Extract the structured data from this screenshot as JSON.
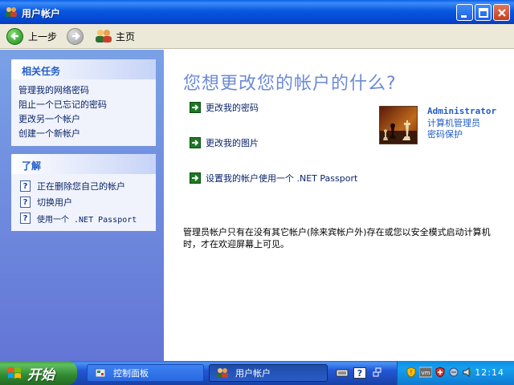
{
  "window": {
    "title": "用户帐户"
  },
  "toolbar": {
    "back_label": "上一步",
    "home_label": "主页"
  },
  "sidebar": {
    "tasks_header": "相关任务",
    "tasks": [
      "管理我的网络密码",
      "阻止一个已忘记的密码",
      "更改另一个帐户",
      "创建一个新帐户"
    ],
    "learn_header": "了解",
    "learn": [
      "正在删除您自己的帐户",
      "切换用户",
      "使用一个 .NET Passport"
    ]
  },
  "main": {
    "heading": "您想更改您的帐户的什么?",
    "actions": [
      "更改我的密码",
      "更改我的图片",
      "设置我的帐户使用一个 .NET Passport"
    ],
    "user": {
      "name": "Administrator",
      "role": "计算机管理员",
      "status": "密码保护"
    },
    "note": "管理员帐户只有在没有其它帐户(除来宾帐户外)存在或您以安全模式启动计算机时，才在欢迎屏幕上可见。"
  },
  "taskbar": {
    "start_label": "开始",
    "buttons": [
      "控制面板",
      "用户帐户"
    ],
    "clock": "12:14"
  },
  "colors": {
    "titlebar": "#0a5fe8",
    "heading": "#6b8bd6",
    "link": "#0a246a",
    "start": "#3c9c3c"
  }
}
